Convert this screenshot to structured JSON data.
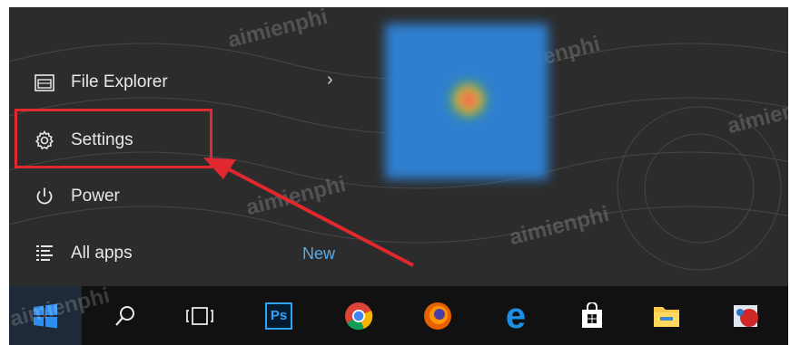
{
  "start_menu": {
    "items": [
      {
        "label": "File Explorer",
        "icon": "file-explorer-icon"
      },
      {
        "label": "Settings",
        "icon": "gear-icon"
      },
      {
        "label": "Power",
        "icon": "power-icon"
      },
      {
        "label": "All apps",
        "icon": "all-apps-icon"
      }
    ],
    "all_apps_badge": "New",
    "file_explorer_expand_icon": "chevron-right-icon"
  },
  "taskbar": {
    "items": [
      {
        "icon": "windows-start-icon"
      },
      {
        "icon": "search-icon"
      },
      {
        "icon": "task-view-icon"
      },
      {
        "icon": "photoshop-icon",
        "label": "Ps"
      },
      {
        "icon": "chrome-icon"
      },
      {
        "icon": "firefox-icon"
      },
      {
        "icon": "edge-icon"
      },
      {
        "icon": "store-icon"
      },
      {
        "icon": "folder-icon"
      },
      {
        "icon": "paint-icon"
      }
    ]
  },
  "watermark_text": "aimienphi",
  "colors": {
    "menu_bg": "#2c2c2c",
    "taskbar_bg": "#111111",
    "highlight": "#e0282e",
    "accent_blue": "#5aa9e6"
  }
}
